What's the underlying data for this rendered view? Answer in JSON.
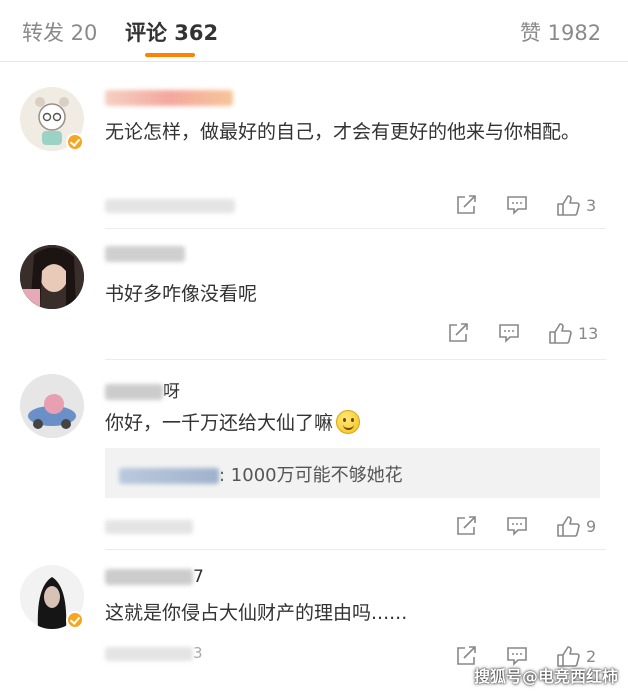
{
  "tabs": {
    "reposts": "转发 20",
    "comments": "评论 362",
    "likes": "赞 1982"
  },
  "colors": {
    "accent": "#ff8200",
    "badge": "#f5a623"
  },
  "comments": [
    {
      "name_visible": "",
      "verified": true,
      "text": "无论怎样，做最好的自己，才会有更好的他来与你相配。",
      "like_count": "3"
    },
    {
      "name_visible": "",
      "verified": false,
      "text": "书好多咋像没看呢",
      "like_count": "13"
    },
    {
      "name_visible": "呀",
      "verified": false,
      "text": "你好，一千万还给大仙了嘛",
      "emoji": "smile-emoji",
      "reply_text": ": 1000万可能不够她花",
      "like_count": "9"
    },
    {
      "name_visible": "7",
      "verified": true,
      "text": "这就是你侵占大仙财产的理由吗......",
      "meta_visible": "3",
      "like_count": "2"
    }
  ],
  "icons": {
    "share": "share-icon",
    "reply": "comment-icon",
    "like": "thumbs-up-icon"
  },
  "watermark": "搜狐号@电竞西红柿"
}
